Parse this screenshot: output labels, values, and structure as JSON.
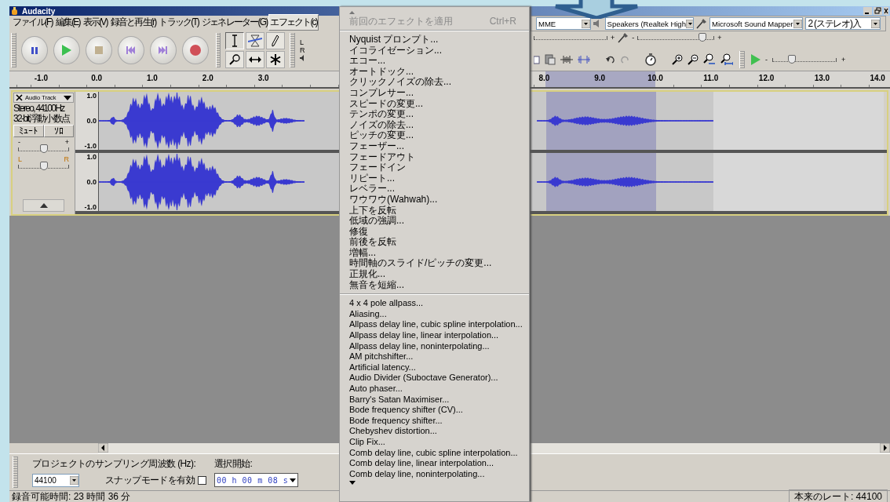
{
  "window": {
    "title": "Audacity"
  },
  "menu_bar": [
    {
      "label": "ファイル(F)",
      "selected": false
    },
    {
      "label": "編集(E)",
      "selected": false
    },
    {
      "label": "表示(V)",
      "selected": false
    },
    {
      "label": "録音と再生(r)",
      "selected": false
    },
    {
      "label": "トラック(T)",
      "selected": false
    },
    {
      "label": "ジェネレーター(G)",
      "selected": false
    },
    {
      "label": "エフェクト(c)",
      "selected": true
    }
  ],
  "device_toolbar": {
    "host": "MME",
    "output": "Speakers (Realtek High",
    "input": "Microsoft Sound Mapper",
    "channels": "2 (ステレオ)入"
  },
  "meter": {
    "left": "L",
    "right": "R"
  },
  "mixer": {
    "output_plus": "+",
    "input": {
      "minus": "-",
      "plus": "+",
      "level": 0.85
    }
  },
  "play_at_speed": {
    "minus": "-",
    "plus": "+",
    "level": 0.3
  },
  "ruler": {
    "left_labels": [
      "-1.0",
      "0.0",
      "1.0",
      "2.0",
      "3.0"
    ],
    "right_labels": [
      "8.0",
      "9.0",
      "10.0",
      "11.0",
      "12.0",
      "13.0",
      "14.0"
    ]
  },
  "track": {
    "name": "Audio Track",
    "info": [
      "Stereo, 44100Hz",
      "32-bit浮動小数点"
    ],
    "buttons": [
      {
        "label": "ﾐｭｰﾄ",
        "selected": false
      },
      {
        "label": "ｿﾛ",
        "selected": false
      }
    ],
    "gain": {
      "minus": "-",
      "plus": "+",
      "level": 0.5
    },
    "pan": {
      "left": "L",
      "right": "R",
      "level": 0.5
    },
    "channels": [
      {
        "scale": [
          "1.0",
          "0.0",
          "-1.0"
        ]
      },
      {
        "scale": [
          "1.0",
          "0.0",
          "-1.0"
        ]
      }
    ]
  },
  "effect_menu": {
    "recent": {
      "label": "前回のエフェクトを適用",
      "shortcut": "Ctrl+R",
      "disabled": true
    },
    "builtin": [
      "Nyquist プロンプト...",
      "イコライゼーション...",
      "エコー...",
      "オートドック...",
      "クリックノイズの除去...",
      "コンプレサー...",
      "スピードの変更...",
      "テンポの変更...",
      "ノイズの除去...",
      "ピッチの変更...",
      "フェーザー...",
      "フェードアウト",
      "フェードイン",
      "リピート...",
      "レベラー...",
      "ワウワウ(Wahwah)...",
      "上下を反転",
      "低域の強調...",
      "修復",
      "前後を反転",
      "増幅...",
      "時間軸のスライド/ピッチの変更...",
      "正規化...",
      "無音を短縮..."
    ],
    "plugins": [
      "4 x 4 pole allpass...",
      "Aliasing...",
      "Allpass delay line, cubic spline interpolation...",
      "Allpass delay line, linear interpolation...",
      "Allpass delay line, noninterpolating...",
      "AM pitchshifter...",
      "Artificial latency...",
      "Audio Divider (Suboctave Generator)...",
      "Auto phaser...",
      "Barry's Satan Maximiser...",
      "Bode frequency shifter (CV)...",
      "Bode frequency shifter...",
      "Chebyshev distortion...",
      "Clip Fix...",
      "Comb delay line, cubic spline interpolation...",
      "Comb delay line, linear interpolation...",
      "Comb delay line, noninterpolating..."
    ]
  },
  "selection_toolbar": {
    "rate_label": "プロジェクトのサンプリング周波数 (Hz):",
    "rate": "44100",
    "snap": {
      "label": "スナップモードを有効",
      "checked": false
    },
    "start_label": "選択開始:",
    "start": "00 h 00 m 08 s"
  },
  "status_bar": {
    "left": "録音可能時間: 23 時間 36 分",
    "right": "本来のレート: 44100"
  }
}
